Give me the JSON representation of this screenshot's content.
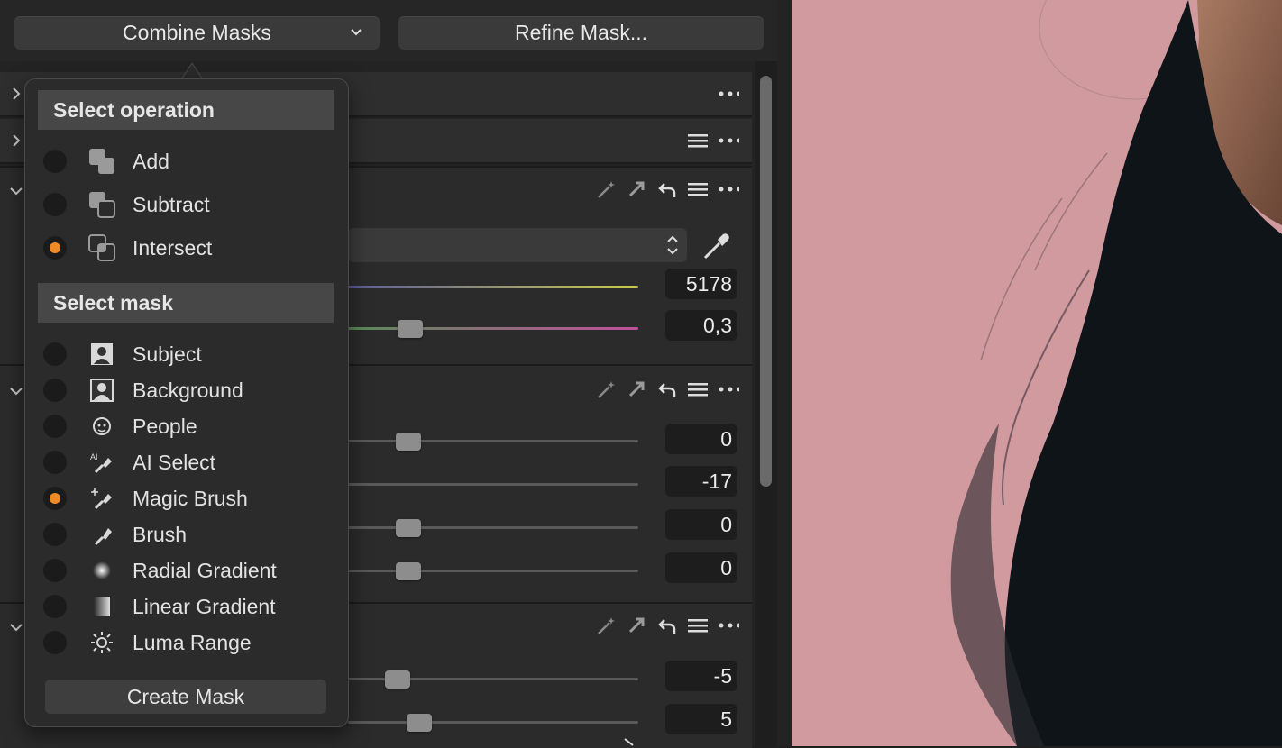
{
  "toolbar": {
    "combine_label": "Combine Masks",
    "refine_label": "Refine Mask..."
  },
  "popup": {
    "operation_heading": "Select operation",
    "operations": [
      {
        "label": "Add",
        "selected": false,
        "icon": "add-mask-icon"
      },
      {
        "label": "Subtract",
        "selected": false,
        "icon": "subtract-mask-icon"
      },
      {
        "label": "Intersect",
        "selected": true,
        "icon": "intersect-mask-icon"
      }
    ],
    "mask_heading": "Select mask",
    "masks": [
      {
        "label": "Subject",
        "selected": false,
        "icon": "subject-icon"
      },
      {
        "label": "Background",
        "selected": false,
        "icon": "background-icon"
      },
      {
        "label": "People",
        "selected": false,
        "icon": "people-icon"
      },
      {
        "label": "AI Select",
        "selected": false,
        "icon": "ai-select-icon"
      },
      {
        "label": "Magic Brush",
        "selected": true,
        "icon": "magic-brush-icon"
      },
      {
        "label": "Brush",
        "selected": false,
        "icon": "brush-icon"
      },
      {
        "label": "Radial Gradient",
        "selected": false,
        "icon": "radial-gradient-icon"
      },
      {
        "label": "Linear Gradient",
        "selected": false,
        "icon": "linear-gradient-icon"
      },
      {
        "label": "Luma Range",
        "selected": false,
        "icon": "luma-range-icon"
      }
    ],
    "create_label": "Create Mask"
  },
  "panel": {
    "white_balance": {
      "kelvin": "5178",
      "tint": "0,3"
    },
    "exposure": {
      "values": [
        "0",
        "-17",
        "0",
        "0"
      ]
    },
    "third": {
      "values": [
        "-5",
        "5"
      ]
    }
  },
  "colors": {
    "accent": "#f08a24",
    "background_photo": "#d09a9e"
  }
}
